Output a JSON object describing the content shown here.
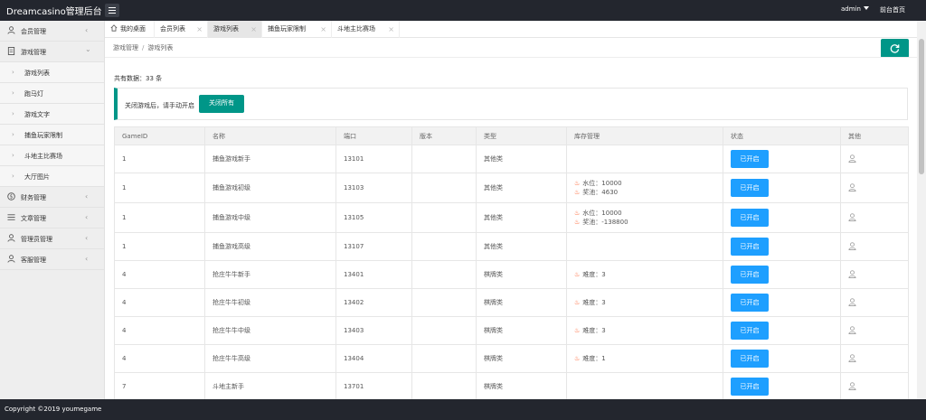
{
  "app": {
    "title": "Dreamcasino管理后台",
    "user": "admin",
    "front_link": "前台首页",
    "footer": "Copyright ©2019 youmegame"
  },
  "sidebar": {
    "groups": [
      {
        "label": "会员管理",
        "icon": "user-icon",
        "expanded": false
      },
      {
        "label": "游戏管理",
        "icon": "document-icon",
        "expanded": true,
        "items": [
          "游戏列表",
          "跑马灯",
          "游戏文字",
          "捕鱼玩家限制",
          "斗地主比赛场",
          "大厅图片"
        ]
      },
      {
        "label": "财务管理",
        "icon": "dollar-icon",
        "expanded": false
      },
      {
        "label": "文章管理",
        "icon": "list-icon",
        "expanded": false
      },
      {
        "label": "管理员管理",
        "icon": "admin-icon",
        "expanded": false
      },
      {
        "label": "客服管理",
        "icon": "support-icon",
        "expanded": false
      }
    ]
  },
  "tabs": [
    {
      "label": "我的桌面",
      "icon": "home-icon",
      "closable": false
    },
    {
      "label": "会员列表",
      "closable": true
    },
    {
      "label": "游戏列表",
      "closable": true,
      "active": true
    },
    {
      "label": "捕鱼玩家限制",
      "closable": true
    },
    {
      "label": "斗地主比赛场",
      "closable": true
    }
  ],
  "breadcrumb": [
    "游戏管理",
    "游戏列表"
  ],
  "summary": {
    "total_text": "共有数据：33 条"
  },
  "notice": {
    "text": "关闭游戏后，请手动开启",
    "button": "关闭所有"
  },
  "table": {
    "headers": [
      "GameID",
      "名称",
      "端口",
      "版本",
      "类型",
      "库存管理",
      "状态",
      "其他"
    ],
    "rows": [
      {
        "id": "1",
        "name": "捕鱼游戏新手",
        "port": "13101",
        "version": "",
        "type": "其他类",
        "type_kind": "other",
        "stock": [],
        "status": "已开启"
      },
      {
        "id": "1",
        "name": "捕鱼游戏初级",
        "port": "13103",
        "version": "",
        "type": "其他类",
        "type_kind": "other",
        "stock": [
          "水位：10000",
          "奖池：4630"
        ],
        "status": "已开启"
      },
      {
        "id": "1",
        "name": "捕鱼游戏中级",
        "port": "13105",
        "version": "",
        "type": "其他类",
        "type_kind": "other",
        "stock": [
          "水位：10000",
          "奖池：-138800"
        ],
        "status": "已开启"
      },
      {
        "id": "1",
        "name": "捕鱼游戏高级",
        "port": "13107",
        "version": "",
        "type": "其他类",
        "type_kind": "other",
        "stock": [],
        "status": "已开启"
      },
      {
        "id": "4",
        "name": "抢庄牛牛新手",
        "port": "13401",
        "version": "",
        "type": "棋牌类",
        "type_kind": "card",
        "stock": [
          "难度：3"
        ],
        "status": "已开启"
      },
      {
        "id": "4",
        "name": "抢庄牛牛初级",
        "port": "13402",
        "version": "",
        "type": "棋牌类",
        "type_kind": "card",
        "stock": [
          "难度：3"
        ],
        "status": "已开启"
      },
      {
        "id": "4",
        "name": "抢庄牛牛中级",
        "port": "13403",
        "version": "",
        "type": "棋牌类",
        "type_kind": "card",
        "stock": [
          "难度：3"
        ],
        "status": "已开启"
      },
      {
        "id": "4",
        "name": "抢庄牛牛高级",
        "port": "13404",
        "version": "",
        "type": "棋牌类",
        "type_kind": "card",
        "stock": [
          "难度：1"
        ],
        "status": "已开启"
      },
      {
        "id": "7",
        "name": "斗地主新手",
        "port": "13701",
        "version": "",
        "type": "棋牌类",
        "type_kind": "card",
        "stock": [],
        "status": "已开启"
      }
    ]
  },
  "colors": {
    "topbar": "#23262e",
    "primary": "#009688",
    "status_button": "#1e9fff",
    "type_other": "#2eaa2e",
    "type_card": "#e54545",
    "flame": "#ff5722"
  }
}
